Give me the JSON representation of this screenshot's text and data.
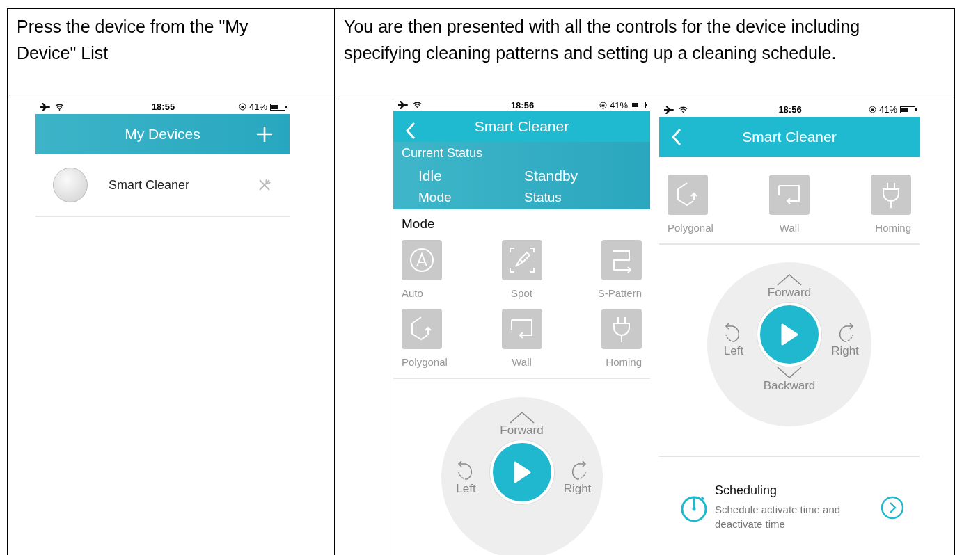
{
  "instructions": [
    {
      "text": "Press the device from the \"My Device\" List"
    },
    {
      "text": "You are then presented with all the controls for the device including specifying cleaning patterns and setting up a cleaning schedule."
    }
  ],
  "screens": [
    {
      "kind": "device_list",
      "status_bar": {
        "time": "18:55",
        "battery": "41%"
      },
      "title": "My Devices",
      "devices": [
        {
          "name": "Smart Cleaner"
        }
      ]
    },
    {
      "kind": "control",
      "status_bar": {
        "time": "18:56",
        "battery": "41%"
      },
      "title": "Smart Cleaner",
      "current_status": {
        "heading": "Current Status",
        "items": [
          {
            "value": "Idle",
            "label": "Mode"
          },
          {
            "value": "Standby",
            "label": "Status"
          }
        ]
      },
      "mode_heading": "Mode",
      "modes": [
        {
          "kind": "auto",
          "label": "Auto"
        },
        {
          "kind": "spot",
          "label": "Spot"
        },
        {
          "kind": "s_pattern",
          "label": "S-Pattern"
        },
        {
          "kind": "polygonal",
          "label": "Polygonal"
        },
        {
          "kind": "wall",
          "label": "Wall"
        },
        {
          "kind": "homing",
          "label": "Homing"
        }
      ],
      "joystick": {
        "forward": "Forward",
        "left": "Left",
        "right": "Right"
      }
    },
    {
      "kind": "control",
      "status_bar": {
        "time": "18:56",
        "battery": "41%"
      },
      "title": "Smart Cleaner",
      "modes": [
        {
          "kind": "polygonal",
          "label": "Polygonal"
        },
        {
          "kind": "wall",
          "label": "Wall"
        },
        {
          "kind": "homing",
          "label": "Homing"
        }
      ],
      "joystick": {
        "forward": "Forward",
        "left": "Left",
        "right": "Right",
        "backward": "Backward"
      },
      "scheduling": {
        "title": "Scheduling",
        "description": "Schedule activate time and deactivate time"
      }
    }
  ]
}
